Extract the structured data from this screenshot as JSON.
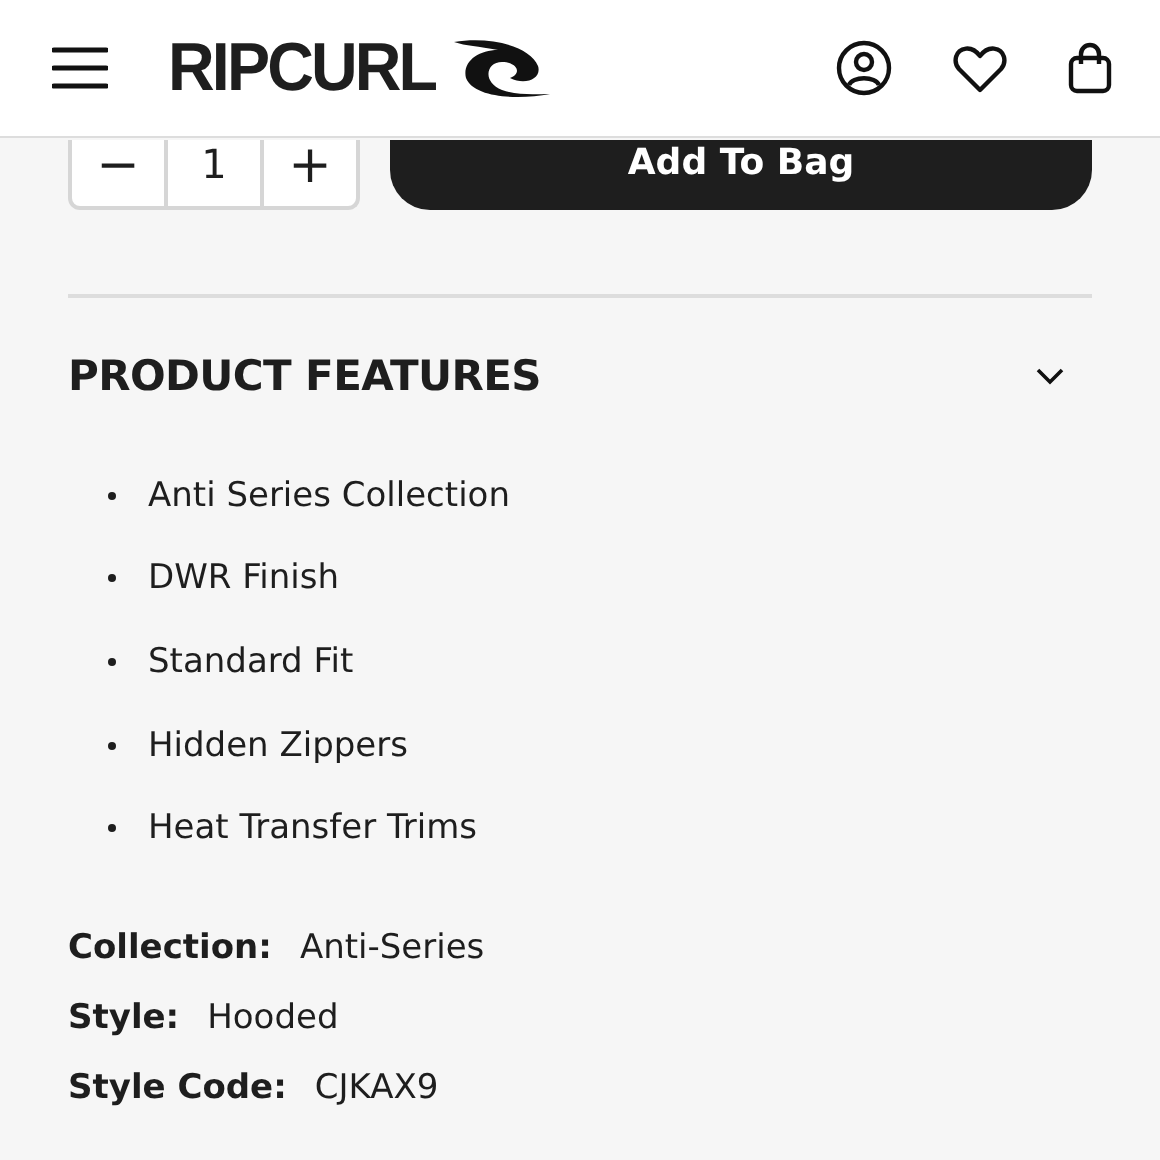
{
  "header": {
    "logo": "RIPCURL"
  },
  "purchase": {
    "minus": "−",
    "quantity": "1",
    "plus": "+",
    "button": "Add To Bag"
  },
  "features": {
    "title": "PRODUCT FEATURES",
    "expanded": true,
    "items": [
      "Anti Series Collection",
      "DWR Finish",
      "Standard Fit",
      "Hidden Zippers",
      "Heat Transfer Trims"
    ]
  },
  "details": [
    {
      "label": "Collection:",
      "value": "Anti-Series"
    },
    {
      "label": "Style:",
      "value": "Hooded"
    },
    {
      "label": "Style Code:",
      "value": "CJKAX9"
    }
  ]
}
